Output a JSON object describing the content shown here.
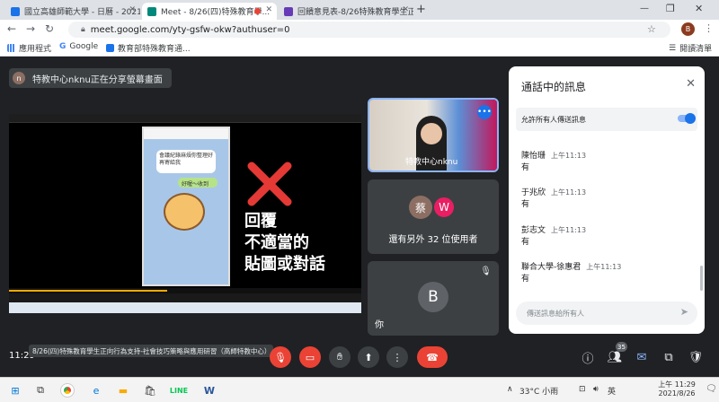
{
  "tabs": [
    {
      "title": "國立高雄師範大學 - 日曆 - 2021年...",
      "fav_color": "#1a73e8"
    },
    {
      "title": "Meet - 8/26(四)特殊教育學...",
      "fav_color": "#00897b"
    },
    {
      "title": "回饋意見表-8/26特殊教育學生正...",
      "fav_color": "#673ab7"
    }
  ],
  "address": {
    "url": "meet.google.com/yty-gsfw-okw?authuser=0",
    "profile_initial": "B"
  },
  "bookmarks": [
    {
      "label": "應用程式",
      "color": "#5f6368"
    },
    {
      "label": "Google",
      "color": "#4285f4"
    },
    {
      "label": "教育部特殊教育通...",
      "color": "#1a73e8"
    }
  ],
  "reading_list": "閱讀清單",
  "share": {
    "avatar": "n",
    "text": "特教中心nknu正在分享螢幕畫面"
  },
  "slide": {
    "bubble1": "會議紀錄麻煩你整理好再寄給我",
    "bubble2": "好喔～收到",
    "caption_lines": [
      "回覆",
      "不適當的",
      "貼圖或對話"
    ]
  },
  "tiles": {
    "presenter_name": "特教中心nknu",
    "others_avatars": [
      {
        "initial": "蔡",
        "color": "#8d6e63"
      },
      {
        "initial": "W",
        "color": "#e91e63"
      }
    ],
    "others_text": "還有另外 32 位使用者",
    "self_initial": "B",
    "self_label": "你"
  },
  "chat": {
    "title": "通話中的訊息",
    "allow_label": "允許所有人傳送訊息",
    "messages": [
      {
        "sender": "陳怡珊",
        "time": "上午11:13",
        "text": "有"
      },
      {
        "sender": "于兆欣",
        "time": "上午11:13",
        "text": "有"
      },
      {
        "sender": "彭志文",
        "time": "上午11:13",
        "text": "有"
      },
      {
        "sender": "聯合大學-徐惠君",
        "time": "上午11:13",
        "text": "有"
      }
    ],
    "input_placeholder": "傳送訊息給所有人"
  },
  "controls": {
    "time": "11:29",
    "meeting_title": "8/26(四)特殊教育學生正向行為支持-社會技巧策略與應用研習（高師特教中心）",
    "participant_count": "35"
  },
  "taskbar": {
    "weather": "33°C 小雨",
    "ime": "英",
    "time": "上午 11:29",
    "date": "2021/8/26"
  }
}
